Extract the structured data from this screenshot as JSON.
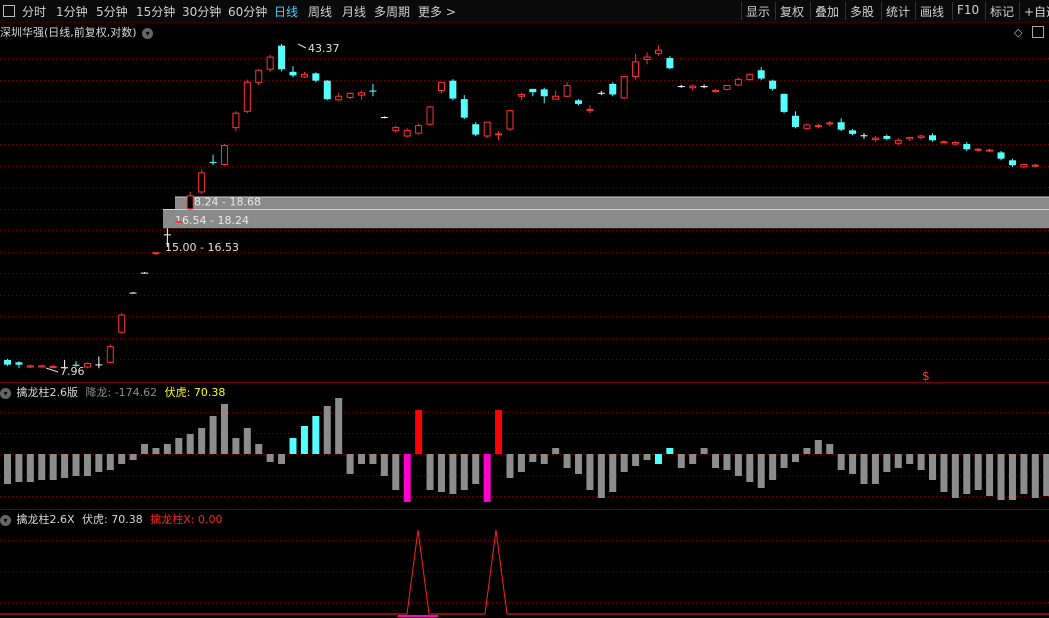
{
  "toolbar": {
    "left_items": [
      "分时",
      "1分钟",
      "5分钟",
      "15分钟",
      "30分钟",
      "60分钟",
      "日线",
      "周线",
      "月线",
      "多周期",
      "更多 >"
    ],
    "active": "日线",
    "right_items": [
      "显示",
      "复权",
      "叠加",
      "多股",
      "统计",
      "画线",
      "F10",
      "标记",
      "+自选"
    ]
  },
  "main_panel": {
    "title": "深圳华强(日线,前复权,对数)",
    "high_label": "43.37",
    "low_label": "7.96",
    "zones": [
      "18.24 - 18.68",
      "16.54 - 18.24",
      "15.00 - 16.53"
    ],
    "signal_marker": "$"
  },
  "indicator1": {
    "name": "擒龙柱2.6版",
    "line1_label": "降龙: -174.62",
    "line2_label": "伏虎: 70.38"
  },
  "indicator2": {
    "name": "擒龙柱2.6X",
    "line1_label": "伏虎: 70.38",
    "line2_label": "擒龙柱X: 0.00"
  },
  "colors": {
    "up": "#ff3232",
    "down": "#54ffff",
    "neutral": "#ffffff",
    "bar_gray": "#8c8c8c",
    "bar_red": "#ff0000",
    "bar_magenta": "#ff00cc",
    "grid": "#7a0000",
    "zone_fill": "#8a8a8a"
  },
  "chart_data": {
    "type": "candlestick",
    "candles": [
      [
        8.3,
        8.35,
        8.1,
        8.05,
        "down"
      ],
      [
        8.2,
        8.25,
        8.1,
        7.95,
        "down"
      ],
      [
        8.0,
        8.1,
        8.05,
        7.96,
        "up"
      ],
      [
        8.05,
        8.1,
        8.0,
        7.98,
        "up"
      ],
      [
        8.0,
        8.1,
        8.02,
        7.98,
        "up"
      ],
      [
        7.98,
        8.3,
        7.99,
        7.96,
        "neutral"
      ],
      [
        8.1,
        8.25,
        8.05,
        8.0,
        "down"
      ],
      [
        8.0,
        8.2,
        8.15,
        7.95,
        "up"
      ],
      [
        8.1,
        8.45,
        8.11,
        7.95,
        "neutral"
      ],
      [
        8.2,
        9.0,
        8.9,
        8.15,
        "up"
      ],
      [
        9.6,
        10.6,
        10.5,
        9.55,
        "up"
      ],
      [
        11.8,
        11.85,
        11.81,
        11.78,
        "neutral"
      ],
      [
        13.1,
        13.15,
        13.11,
        13.05,
        "neutral"
      ],
      [
        14.5,
        14.6,
        14.55,
        14.4,
        "up"
      ],
      [
        16.0,
        16.53,
        16.02,
        15.0,
        "neutral"
      ],
      [
        17.0,
        17.2,
        17.1,
        16.9,
        "up"
      ],
      [
        18.3,
        20.0,
        19.6,
        18.2,
        "up"
      ],
      [
        20.0,
        22.5,
        22.1,
        19.8,
        "up"
      ],
      [
        23.4,
        24.3,
        23.4,
        23.0,
        "down"
      ],
      [
        23.1,
        25.7,
        25.5,
        23.0,
        "up"
      ],
      [
        28.0,
        30.5,
        30.2,
        27.5,
        "up"
      ],
      [
        30.5,
        36.0,
        35.5,
        30.2,
        "up"
      ],
      [
        35.5,
        38.0,
        37.8,
        35.0,
        "up"
      ],
      [
        38.0,
        41.0,
        40.5,
        37.5,
        "up"
      ],
      [
        43.0,
        43.37,
        38.0,
        37.6,
        "down"
      ],
      [
        37.5,
        38.6,
        36.8,
        36.5,
        "down"
      ],
      [
        36.5,
        37.5,
        37.0,
        36.3,
        "up"
      ],
      [
        37.2,
        37.4,
        35.8,
        35.5,
        "down"
      ],
      [
        35.8,
        35.9,
        32.5,
        32.3,
        "down"
      ],
      [
        32.4,
        33.6,
        33.0,
        32.2,
        "up"
      ],
      [
        32.8,
        33.7,
        33.5,
        32.5,
        "up"
      ],
      [
        33.2,
        34.0,
        33.6,
        32.4,
        "up"
      ],
      [
        33.8,
        35.2,
        34.0,
        33.0,
        "down"
      ],
      [
        29.5,
        29.7,
        29.6,
        29.4,
        "neutral"
      ],
      [
        28.0,
        28.3,
        27.6,
        27.2,
        "up"
      ],
      [
        27.6,
        27.9,
        26.8,
        26.6,
        "up"
      ],
      [
        27.2,
        28.6,
        28.3,
        27.0,
        "up"
      ],
      [
        28.5,
        31.4,
        31.2,
        28.3,
        "up"
      ],
      [
        34.0,
        34.5,
        35.5,
        33.5,
        "up"
      ],
      [
        35.8,
        36.1,
        32.6,
        32.3,
        "down"
      ],
      [
        32.5,
        33.2,
        29.5,
        29.3,
        "down"
      ],
      [
        28.5,
        28.8,
        27.0,
        26.8,
        "down"
      ],
      [
        26.8,
        28.9,
        28.8,
        26.5,
        "up"
      ],
      [
        27.1,
        27.5,
        27.0,
        26.2,
        "up"
      ],
      [
        27.8,
        30.7,
        30.6,
        27.5,
        "up"
      ],
      [
        33.0,
        33.6,
        33.3,
        32.3,
        "up"
      ],
      [
        33.7,
        34.1,
        34.3,
        33.0,
        "down"
      ],
      [
        34.2,
        34.5,
        33.0,
        31.8,
        "down"
      ],
      [
        32.5,
        34.0,
        33.0,
        32.4,
        "up"
      ],
      [
        33.0,
        35.5,
        34.9,
        32.8,
        "up"
      ],
      [
        32.3,
        32.5,
        31.7,
        31.5,
        "down"
      ],
      [
        30.8,
        31.5,
        30.7,
        30.2,
        "up"
      ],
      [
        33.6,
        33.9,
        33.5,
        33.2,
        "neutral"
      ],
      [
        33.3,
        35.5,
        35.2,
        33.0,
        "down"
      ],
      [
        32.7,
        32.8,
        36.6,
        32.5,
        "up"
      ],
      [
        36.6,
        41.2,
        39.5,
        36.0,
        "up"
      ],
      [
        40.0,
        41.5,
        40.5,
        39.0,
        "up"
      ],
      [
        41.3,
        43.0,
        42.0,
        40.8,
        "up"
      ],
      [
        40.3,
        40.7,
        38.2,
        38.0,
        "down"
      ],
      [
        34.8,
        35.0,
        34.7,
        34.5,
        "neutral"
      ],
      [
        34.5,
        35.1,
        34.8,
        34.0,
        "up"
      ],
      [
        34.8,
        35.1,
        34.6,
        34.4,
        "neutral"
      ],
      [
        34.0,
        34.3,
        33.8,
        33.6,
        "up"
      ],
      [
        34.2,
        35.0,
        34.9,
        34.0,
        "up"
      ],
      [
        35.0,
        36.3,
        36.0,
        34.8,
        "up"
      ],
      [
        36.0,
        37.2,
        37.0,
        35.8,
        "up"
      ],
      [
        37.8,
        38.4,
        36.2,
        35.9,
        "down"
      ],
      [
        35.8,
        36.0,
        34.3,
        34.0,
        "down"
      ],
      [
        33.4,
        33.5,
        30.4,
        30.2,
        "down"
      ],
      [
        29.8,
        30.5,
        28.1,
        27.9,
        "down"
      ],
      [
        28.4,
        28.6,
        27.9,
        27.7,
        "up"
      ],
      [
        28.2,
        28.6,
        28.3,
        27.9,
        "up"
      ],
      [
        28.6,
        29.0,
        28.7,
        28.2,
        "up"
      ],
      [
        28.8,
        29.4,
        27.7,
        27.5,
        "down"
      ],
      [
        27.6,
        27.8,
        27.1,
        26.9,
        "down"
      ],
      [
        26.8,
        27.2,
        26.9,
        26.4,
        "neutral"
      ],
      [
        26.5,
        26.8,
        26.3,
        26.0,
        "up"
      ],
      [
        26.8,
        27.0,
        26.4,
        26.2,
        "down"
      ],
      [
        26.2,
        26.5,
        25.8,
        25.5,
        "up"
      ],
      [
        26.4,
        26.7,
        26.6,
        26.1,
        "up"
      ],
      [
        26.6,
        27.0,
        26.8,
        26.3,
        "up"
      ],
      [
        26.9,
        27.2,
        26.2,
        26.0,
        "down"
      ],
      [
        26.0,
        26.2,
        25.9,
        25.8,
        "up"
      ],
      [
        25.9,
        26.1,
        25.7,
        25.5,
        "up"
      ],
      [
        25.7,
        26.0,
        25.0,
        24.8,
        "down"
      ],
      [
        25.0,
        25.2,
        24.9,
        24.7,
        "up"
      ],
      [
        24.9,
        25.1,
        24.8,
        24.6,
        "up"
      ],
      [
        24.6,
        24.8,
        23.8,
        23.6,
        "down"
      ],
      [
        23.6,
        23.8,
        23.0,
        22.8,
        "down"
      ],
      [
        22.8,
        23.2,
        23.1,
        22.6,
        "up"
      ],
      [
        23.0,
        23.2,
        23.0,
        22.8,
        "up"
      ]
    ],
    "indicator_bars": [
      -30,
      -28,
      -28,
      -26,
      -26,
      -24,
      -22,
      -22,
      -18,
      -16,
      -10,
      -6,
      10,
      6,
      10,
      16,
      20,
      26,
      38,
      50,
      16,
      26,
      10,
      -8,
      -10,
      16,
      28,
      38,
      48,
      56,
      -20,
      -10,
      -10,
      -22,
      -36,
      -26,
      -28,
      -36,
      -38,
      -40,
      -36,
      -30,
      -46,
      -30,
      -24,
      -18,
      -8,
      -10,
      6,
      -14,
      -20,
      -36,
      -44,
      -38,
      -18,
      -12,
      -6,
      -10,
      6,
      -14,
      -10,
      6,
      -14,
      -16,
      -22,
      -28,
      -34,
      -26,
      -14,
      -8,
      6,
      14,
      10,
      -16,
      -20,
      -30,
      -30,
      -18,
      -14,
      -10,
      -16,
      -26,
      -38,
      -44,
      -40,
      -36,
      -42,
      -46,
      -46,
      -40,
      -44,
      -42,
      -44,
      -38,
      -34,
      -40,
      -36,
      -34,
      -36,
      -32,
      -34,
      -32,
      -32,
      -34,
      -34,
      -32,
      -30,
      -32,
      -30,
      -32,
      -28
    ],
    "indicator2_peaks": [
      {
        "index": 36,
        "value": 100
      },
      {
        "index": 43,
        "value": 100
      }
    ]
  }
}
